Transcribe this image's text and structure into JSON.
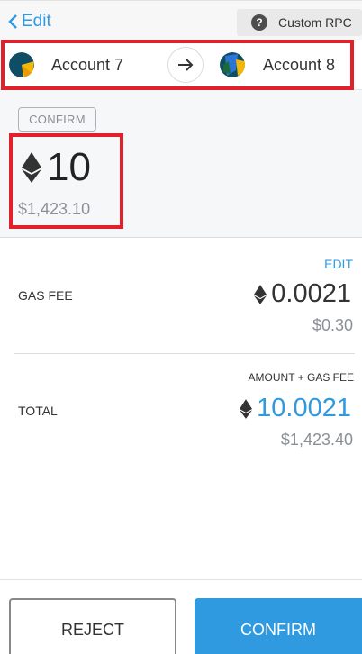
{
  "header": {
    "back_label": "Edit",
    "network_label": "Custom RPC",
    "help_symbol": "?"
  },
  "accounts": {
    "from": "Account 7",
    "to": "Account 8"
  },
  "transaction": {
    "badge": "CONFIRM",
    "amount": "10",
    "amount_fiat": "$1,423.10"
  },
  "gas": {
    "edit_label": "EDIT",
    "label": "GAS FEE",
    "value": "0.0021",
    "fiat": "$0.30"
  },
  "total": {
    "caption": "AMOUNT + GAS FEE",
    "label": "TOTAL",
    "value": "10.0021",
    "fiat": "$1,423.40"
  },
  "buttons": {
    "reject": "REJECT",
    "confirm": "CONFIRM"
  },
  "colors": {
    "accent": "#2f9ae0",
    "highlight": "#e0202a"
  },
  "icons": [
    "chevron-left-icon",
    "help-icon",
    "arrow-right-icon",
    "eth-icon",
    "account-avatar"
  ]
}
